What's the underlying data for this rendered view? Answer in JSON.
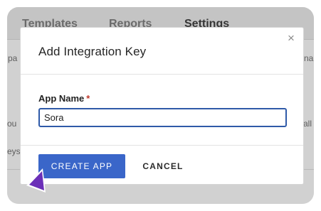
{
  "background": {
    "tabs": [
      {
        "label": "Templates",
        "active": false
      },
      {
        "label": "Reports",
        "active": false
      },
      {
        "label": "Settings",
        "active": true
      }
    ],
    "snippets": [
      "pa",
      "na",
      "ou",
      "all",
      "eys"
    ]
  },
  "modal": {
    "title": "Add Integration Key",
    "close_glyph": "×",
    "field": {
      "label": "App Name",
      "required_mark": "*",
      "value": "Sora"
    },
    "buttons": {
      "create_label": "CREATE APP",
      "cancel_label": "CANCEL"
    }
  },
  "colors": {
    "primary": "#3a66c9",
    "input_border": "#2f5aa8",
    "required": "#c0392b",
    "cursor": "#6b2fb8"
  }
}
